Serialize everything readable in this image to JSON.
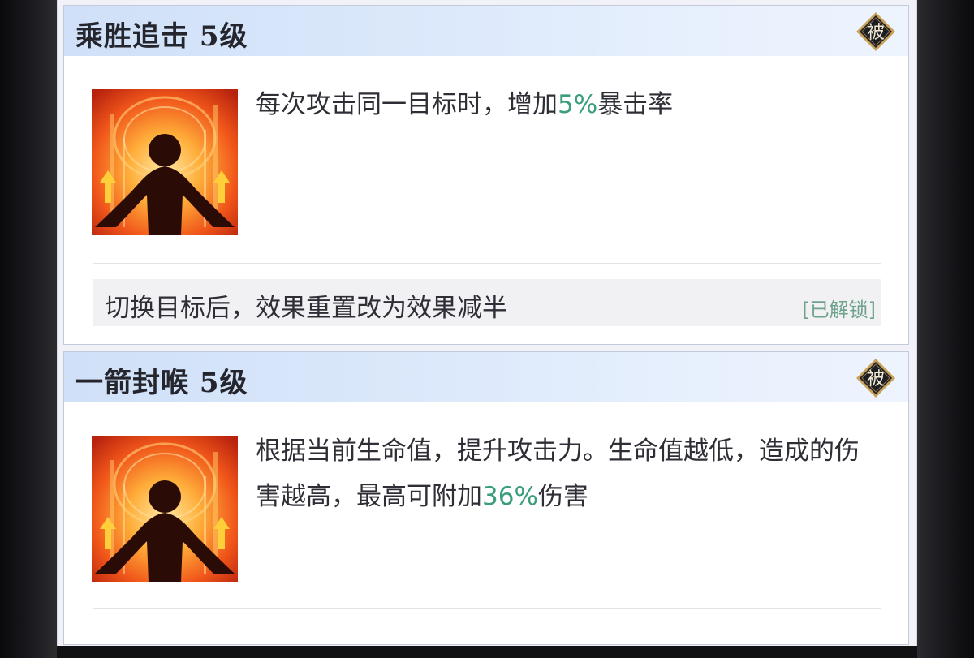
{
  "skills": [
    {
      "title": "乘胜追击 5级",
      "badge": "被",
      "icon": "flame-silhouette-icon",
      "desc_before": "每次攻击同一目标时，增加",
      "desc_highlight": "5%",
      "desc_after": "暴击率",
      "bonus_text": "切换目标后，效果重置改为效果减半",
      "bonus_status": "[已解锁]"
    },
    {
      "title": "一箭封喉 5级",
      "badge": "被",
      "icon": "flame-silhouette-icon",
      "desc_before": "根据当前生命值，提升攻击力。生命值越低，造成的伤害越高，最高可附加",
      "desc_highlight": "36%",
      "desc_after": "伤害"
    }
  ],
  "colors": {
    "highlight": "#3a9e7c",
    "unlocked": "#6fa28c",
    "header_gradient_start": "#cfe0f8",
    "badge_fill": "#1d1d24",
    "badge_border": "#c9a25a"
  }
}
